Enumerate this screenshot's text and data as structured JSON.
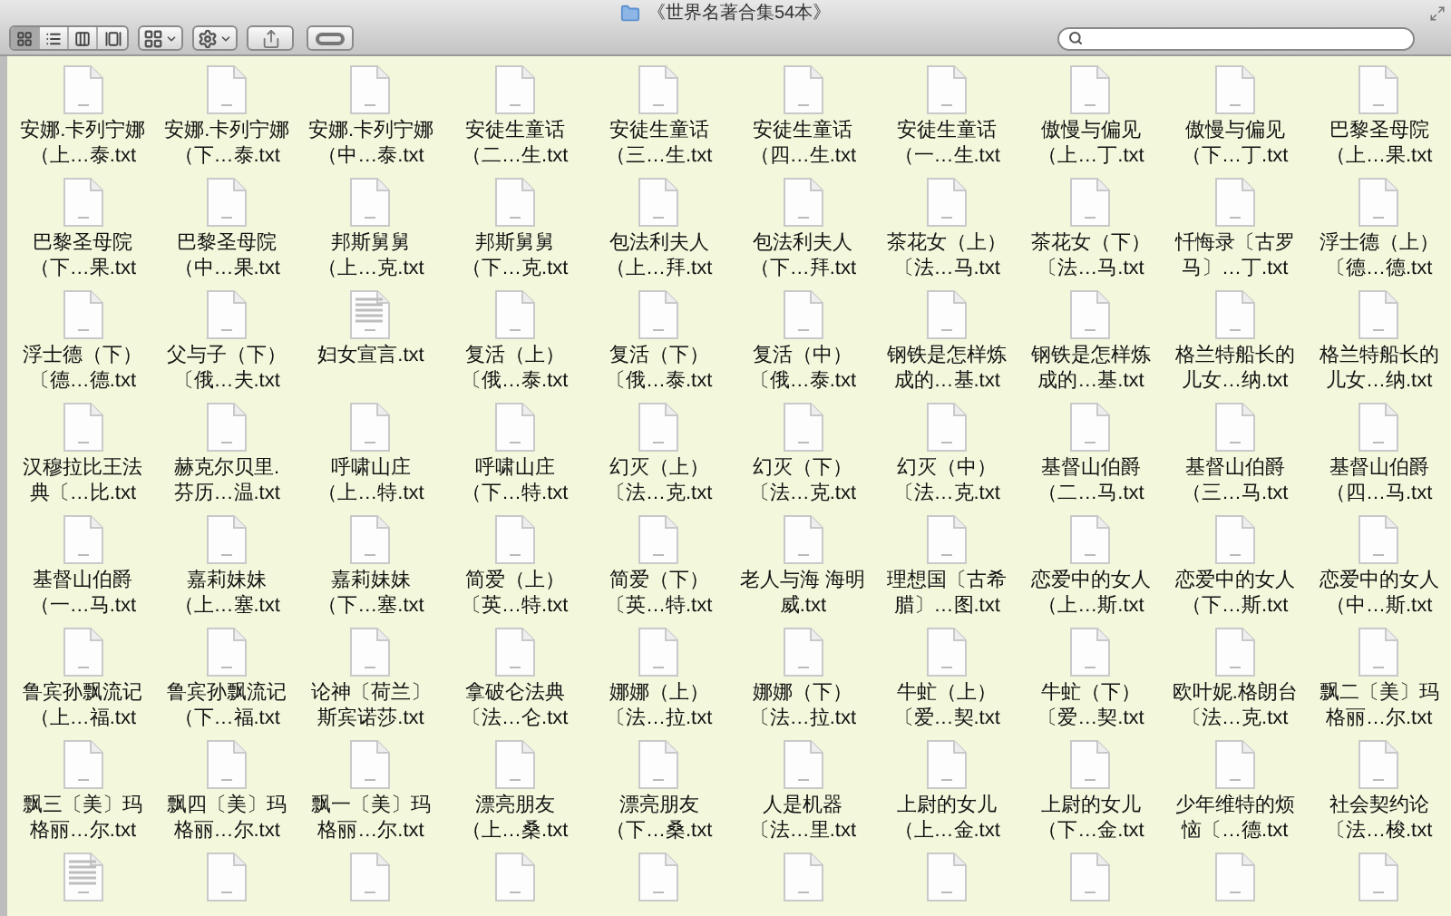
{
  "window": {
    "title": "《世界名著合集54本》"
  },
  "toolbar": {
    "view_buttons": [
      {
        "kind": "icons",
        "selected": true
      },
      {
        "kind": "list",
        "selected": false
      },
      {
        "kind": "columns",
        "selected": false
      },
      {
        "kind": "coverflow",
        "selected": false
      }
    ],
    "buttons": [
      {
        "kind": "arrange",
        "dropdown": true
      },
      {
        "kind": "action",
        "dropdown": true
      },
      {
        "kind": "share",
        "dropdown": false
      },
      {
        "kind": "tag",
        "dropdown": false
      }
    ]
  },
  "files": [
    {
      "kind": "plain",
      "lines": [
        "安娜.卡列宁娜",
        "（上…泰.txt"
      ]
    },
    {
      "kind": "plain",
      "lines": [
        "安娜.卡列宁娜",
        "（下…泰.txt"
      ]
    },
    {
      "kind": "plain",
      "lines": [
        "安娜.卡列宁娜",
        "（中…泰.txt"
      ]
    },
    {
      "kind": "plain",
      "lines": [
        "安徒生童话",
        "（二…生.txt"
      ]
    },
    {
      "kind": "plain",
      "lines": [
        "安徒生童话",
        "（三…生.txt"
      ]
    },
    {
      "kind": "plain",
      "lines": [
        "安徒生童话",
        "（四…生.txt"
      ]
    },
    {
      "kind": "plain",
      "lines": [
        "安徒生童话",
        "（一…生.txt"
      ]
    },
    {
      "kind": "plain",
      "lines": [
        "傲慢与偏见",
        "（上…丁.txt"
      ]
    },
    {
      "kind": "plain",
      "lines": [
        "傲慢与偏见",
        "（下…丁.txt"
      ]
    },
    {
      "kind": "plain",
      "lines": [
        "巴黎圣母院",
        "（上…果.txt"
      ]
    },
    {
      "kind": "plain",
      "lines": [
        "巴黎圣母院",
        "（下…果.txt"
      ]
    },
    {
      "kind": "plain",
      "lines": [
        "巴黎圣母院",
        "（中…果.txt"
      ]
    },
    {
      "kind": "plain",
      "lines": [
        "邦斯舅舅",
        "（上…克.txt"
      ]
    },
    {
      "kind": "plain",
      "lines": [
        "邦斯舅舅",
        "（下…克.txt"
      ]
    },
    {
      "kind": "plain",
      "lines": [
        "包法利夫人",
        "（上…拜.txt"
      ]
    },
    {
      "kind": "plain",
      "lines": [
        "包法利夫人",
        "（下…拜.txt"
      ]
    },
    {
      "kind": "plain",
      "lines": [
        "茶花女（上）",
        "〔法…马.txt"
      ]
    },
    {
      "kind": "plain",
      "lines": [
        "茶花女（下）",
        "〔法…马.txt"
      ]
    },
    {
      "kind": "plain",
      "lines": [
        "忏悔录〔古罗",
        "马〕…丁.txt"
      ]
    },
    {
      "kind": "plain",
      "lines": [
        "浮士德（上）",
        "〔德…德.txt"
      ]
    },
    {
      "kind": "plain",
      "lines": [
        "浮士德（下）",
        "〔德…德.txt"
      ]
    },
    {
      "kind": "plain",
      "lines": [
        "父与子（下）",
        "〔俄…夫.txt"
      ]
    },
    {
      "kind": "preview",
      "lines": [
        "妇女宣言.txt"
      ]
    },
    {
      "kind": "plain",
      "lines": [
        "复活（上）",
        "〔俄…泰.txt"
      ]
    },
    {
      "kind": "plain",
      "lines": [
        "复活（下）",
        "〔俄…泰.txt"
      ]
    },
    {
      "kind": "plain",
      "lines": [
        "复活（中）",
        "〔俄…泰.txt"
      ]
    },
    {
      "kind": "plain",
      "lines": [
        "钢铁是怎样炼",
        "成的…基.txt"
      ]
    },
    {
      "kind": "plain",
      "lines": [
        "钢铁是怎样炼",
        "成的…基.txt"
      ]
    },
    {
      "kind": "plain",
      "lines": [
        "格兰特船长的",
        "儿女…纳.txt"
      ]
    },
    {
      "kind": "plain",
      "lines": [
        "格兰特船长的",
        "儿女…纳.txt"
      ]
    },
    {
      "kind": "plain",
      "lines": [
        "汉穆拉比王法",
        "典〔…比.txt"
      ]
    },
    {
      "kind": "plain",
      "lines": [
        "赫克尔贝里.",
        "芬历…温.txt"
      ]
    },
    {
      "kind": "plain",
      "lines": [
        "呼啸山庄",
        "（上…特.txt"
      ]
    },
    {
      "kind": "plain",
      "lines": [
        "呼啸山庄",
        "（下…特.txt"
      ]
    },
    {
      "kind": "plain",
      "lines": [
        "幻灭（上）",
        "〔法…克.txt"
      ]
    },
    {
      "kind": "plain",
      "lines": [
        "幻灭（下）",
        "〔法…克.txt"
      ]
    },
    {
      "kind": "plain",
      "lines": [
        "幻灭（中）",
        "〔法…克.txt"
      ]
    },
    {
      "kind": "plain",
      "lines": [
        "基督山伯爵",
        "（二…马.txt"
      ]
    },
    {
      "kind": "plain",
      "lines": [
        "基督山伯爵",
        "（三…马.txt"
      ]
    },
    {
      "kind": "plain",
      "lines": [
        "基督山伯爵",
        "（四…马.txt"
      ]
    },
    {
      "kind": "plain",
      "lines": [
        "基督山伯爵",
        "（一…马.txt"
      ]
    },
    {
      "kind": "plain",
      "lines": [
        "嘉莉妹妹",
        "（上…塞.txt"
      ]
    },
    {
      "kind": "plain",
      "lines": [
        "嘉莉妹妹",
        "（下…塞.txt"
      ]
    },
    {
      "kind": "plain",
      "lines": [
        "简爱（上）",
        "〔英…特.txt"
      ]
    },
    {
      "kind": "plain",
      "lines": [
        "简爱（下）",
        "〔英…特.txt"
      ]
    },
    {
      "kind": "plain",
      "lines": [
        "老人与海 海明",
        "威.txt"
      ]
    },
    {
      "kind": "plain",
      "lines": [
        "理想国〔古希",
        "腊〕…图.txt"
      ]
    },
    {
      "kind": "plain",
      "lines": [
        "恋爱中的女人",
        "（上…斯.txt"
      ]
    },
    {
      "kind": "plain",
      "lines": [
        "恋爱中的女人",
        "（下…斯.txt"
      ]
    },
    {
      "kind": "plain",
      "lines": [
        "恋爱中的女人",
        "（中…斯.txt"
      ]
    },
    {
      "kind": "plain",
      "lines": [
        "鲁宾孙飘流记",
        "（上…福.txt"
      ]
    },
    {
      "kind": "plain",
      "lines": [
        "鲁宾孙飘流记",
        "（下…福.txt"
      ]
    },
    {
      "kind": "plain",
      "lines": [
        "论神〔荷兰〕",
        "斯宾诺莎.txt"
      ]
    },
    {
      "kind": "plain",
      "lines": [
        "拿破仑法典",
        "〔法…仑.txt"
      ]
    },
    {
      "kind": "plain",
      "lines": [
        "娜娜（上）",
        "〔法…拉.txt"
      ]
    },
    {
      "kind": "plain",
      "lines": [
        "娜娜（下）",
        "〔法…拉.txt"
      ]
    },
    {
      "kind": "plain",
      "lines": [
        "牛虻（上）",
        "〔爱…契.txt"
      ]
    },
    {
      "kind": "plain",
      "lines": [
        "牛虻（下）",
        "〔爱…契.txt"
      ]
    },
    {
      "kind": "plain",
      "lines": [
        "欧叶妮.格朗台",
        "〔法…克.txt"
      ]
    },
    {
      "kind": "plain",
      "lines": [
        "飘二〔美〕玛",
        "格丽…尔.txt"
      ]
    },
    {
      "kind": "plain",
      "lines": [
        "飘三〔美〕玛",
        "格丽…尔.txt"
      ]
    },
    {
      "kind": "plain",
      "lines": [
        "飘四〔美〕玛",
        "格丽…尔.txt"
      ]
    },
    {
      "kind": "plain",
      "lines": [
        "飘一〔美〕玛",
        "格丽…尔.txt"
      ]
    },
    {
      "kind": "plain",
      "lines": [
        "漂亮朋友",
        "（上…桑.txt"
      ]
    },
    {
      "kind": "plain",
      "lines": [
        "漂亮朋友",
        "（下…桑.txt"
      ]
    },
    {
      "kind": "plain",
      "lines": [
        "人是机器",
        "〔法…里.txt"
      ]
    },
    {
      "kind": "plain",
      "lines": [
        "上尉的女儿",
        "（上…金.txt"
      ]
    },
    {
      "kind": "plain",
      "lines": [
        "上尉的女儿",
        "（下…金.txt"
      ]
    },
    {
      "kind": "plain",
      "lines": [
        "少年维特的烦",
        "恼〔…德.txt"
      ]
    },
    {
      "kind": "plain",
      "lines": [
        "社会契约论",
        "〔法…梭.txt"
      ]
    },
    {
      "kind": "preview"
    },
    {
      "kind": "plain"
    },
    {
      "kind": "plain"
    },
    {
      "kind": "plain"
    },
    {
      "kind": "plain"
    },
    {
      "kind": "plain"
    },
    {
      "kind": "plain"
    },
    {
      "kind": "plain"
    },
    {
      "kind": "plain"
    },
    {
      "kind": "plain"
    }
  ]
}
